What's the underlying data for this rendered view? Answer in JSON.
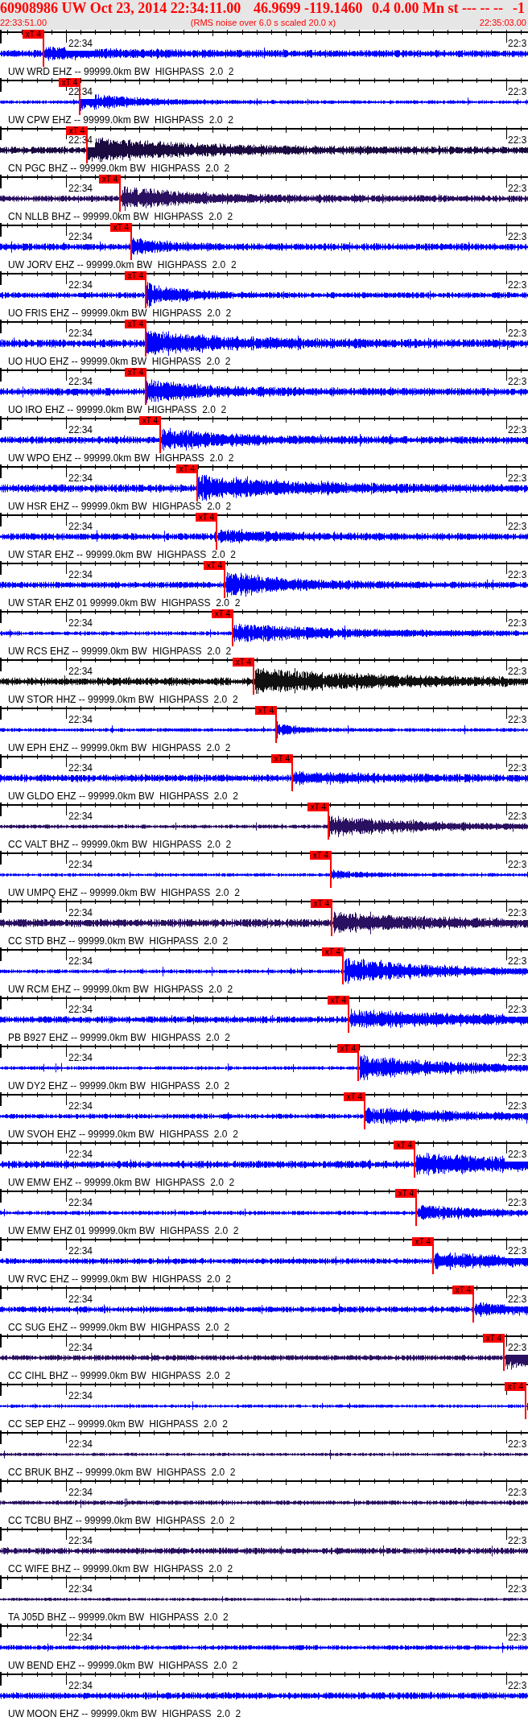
{
  "header": {
    "title_parts": [
      "60908986 UW Oct 23, 2014 22:34:11.00",
      "46.9699 -119.1460",
      "0.4 0.00 Mn st --- -- --",
      "-1"
    ],
    "start_time": "22:33:51.00",
    "note": "(RMS noise over 6.0 s scaled 20.0 x)",
    "end_time": "22:35:03.00"
  },
  "traces": [
    {
      "label": "UW WRD EHZ -- 99999.0km BW  HIGHPASS  2.0  2",
      "color": "#0000ff",
      "time_labels": [
        "22:34",
        "22:3"
      ],
      "pick": {
        "label": "xT 4",
        "level": 0.084
      }
    },
    {
      "label": "UW CPW EHZ -- 99999.0km BW  HIGHPASS  2.0  2",
      "color": "#0000ff",
      "time_labels": [
        "22:34",
        "22:3"
      ],
      "pick": {
        "label": "xT 4",
        "level": 0.152
      }
    },
    {
      "label": "CN PGC BHZ -- 99999.0km BW  HIGHPASS  2.0  2",
      "color": "#1a0a40",
      "time_labels": [
        "22:34",
        "22:3"
      ],
      "pick": {
        "label": "xT 4",
        "level": 0.166
      }
    },
    {
      "label": "CN NLLB BHZ -- 99999.0km BW  HIGHPASS  2.0  2",
      "color": "#2a1060",
      "time_labels": [
        "22:34",
        "22:3"
      ],
      "pick": {
        "label": "xT 4",
        "level": 0.229
      }
    },
    {
      "label": "UW JORV EHZ -- 99999.0km BW  HIGHPASS  2.0  2",
      "color": "#0000ff",
      "time_labels": [
        "22:34",
        "22:3"
      ],
      "pick": {
        "label": "xT 4",
        "level": 0.25
      }
    },
    {
      "label": "UO FRIS EHZ -- 99999.0km BW  HIGHPASS  2.0  2",
      "color": "#0000ff",
      "time_labels": [
        "22:34",
        "22:3"
      ],
      "pick": {
        "label": "xT 4",
        "level": 0.277
      }
    },
    {
      "label": "UO HUO EHZ -- 99999.0km BW  HIGHPASS  2.0  2",
      "color": "#0000ff",
      "time_labels": [
        "22:34",
        "22:3"
      ],
      "pick": {
        "label": "xT 4",
        "level": 0.277
      }
    },
    {
      "label": "UO IRO EHZ -- 99999.0km BW  HIGHPASS  2.0  2",
      "color": "#0000ff",
      "time_labels": [
        "22:34",
        "22:3"
      ],
      "pick": {
        "label": "xT 4",
        "level": 0.277
      }
    },
    {
      "label": "UW WPO EHZ -- 99999.0km BW  HIGHPASS  2.0  2",
      "color": "#0000ff",
      "time_labels": [
        "22:34",
        "22:3"
      ],
      "pick": {
        "label": "xT 4",
        "level": 0.305
      }
    },
    {
      "label": "UW HSR EHZ -- 99999.0km BW  HIGHPASS  2.0  2",
      "color": "#0000ff",
      "time_labels": [
        "22:34",
        "22:3"
      ],
      "pick": {
        "label": "xT 4",
        "level": 0.375
      }
    },
    {
      "label": "UW STAR EHZ -- 99999.0km BW  HIGHPASS  2.0  2",
      "color": "#0000ff",
      "time_labels": [
        "22:34",
        "22:3"
      ],
      "pick": {
        "label": "xT 4",
        "level": 0.412
      }
    },
    {
      "label": "UW STAR EHZ 01 99999.0km BW  HIGHPASS  2.0  2",
      "color": "#0000ff",
      "time_labels": [
        "22:34",
        "22:3"
      ],
      "pick": {
        "label": "xT 4",
        "level": 0.427
      }
    },
    {
      "label": "UW RCS EHZ -- 99999.0km BW  HIGHPASS  2.0  2",
      "color": "#0000ff",
      "time_labels": [
        "22:34",
        "22:3"
      ],
      "pick": {
        "label": "xT 4",
        "level": 0.442
      }
    },
    {
      "label": "UW STOR HHZ -- 99999.0km BW  HIGHPASS  2.0  2",
      "color": "#101010",
      "time_labels": [
        "22:34",
        "22:3"
      ],
      "pick": {
        "label": "xT 4",
        "level": 0.482
      }
    },
    {
      "label": "UW EPH EHZ -- 99999.0km BW  HIGHPASS  2.0  2",
      "color": "#0000ff",
      "time_labels": [
        "22:34",
        "22:3"
      ],
      "pick": {
        "label": "xT 4",
        "level": 0.524
      }
    },
    {
      "label": "UW GLDO EHZ -- 99999.0km BW  HIGHPASS  2.0  2",
      "color": "#0000ff",
      "time_labels": [
        "22:34",
        "22:3"
      ],
      "pick": {
        "label": "xT 4",
        "level": 0.555
      }
    },
    {
      "label": "CC VALT BHZ -- 99999.0km BW  HIGHPASS  2.0  2",
      "color": "#2a1060",
      "time_labels": [
        "22:34",
        "22:3"
      ],
      "pick": {
        "label": "xT 4",
        "level": 0.623
      }
    },
    {
      "label": "UW UMPQ EHZ -- 99999.0km BW  HIGHPASS  2.0  2",
      "color": "#0000ff",
      "time_labels": [
        "22:34",
        "22:3"
      ],
      "pick": {
        "label": "xT 4",
        "level": 0.628
      }
    },
    {
      "label": "CC STD BHZ -- 99999.0km BW  HIGHPASS  2.0  2",
      "color": "#2a1060",
      "time_labels": [
        "22:34",
        "22:3"
      ],
      "pick": {
        "label": "xT 4",
        "level": 0.63
      }
    },
    {
      "label": "UW RCM EHZ -- 99999.0km BW  HIGHPASS  2.0  2",
      "color": "#0000ff",
      "time_labels": [
        "22:34",
        "22:3"
      ],
      "pick": {
        "label": "xT 4",
        "level": 0.651
      }
    },
    {
      "label": "PB B927 EHZ -- 99999.0km BW  HIGHPASS  2.0  2",
      "color": "#0000ff",
      "time_labels": [
        "22:34",
        "22:3"
      ],
      "pick": {
        "label": "xT 4",
        "level": 0.662
      }
    },
    {
      "label": "UW DY2 EHZ -- 99999.0km BW  HIGHPASS  2.0  2",
      "color": "#0000ff",
      "time_labels": [
        "22:34",
        "22:3"
      ],
      "pick": {
        "label": "xT 4",
        "level": 0.68
      }
    },
    {
      "label": "UW SVOH EHZ -- 99999.0km BW  HIGHPASS  2.0  2",
      "color": "#0000ff",
      "time_labels": [
        "22:34",
        "22:3"
      ],
      "pick": {
        "label": "xT 4",
        "level": 0.692
      }
    },
    {
      "label": "UW EMW EHZ -- 99999.0km BW  HIGHPASS  2.0  2",
      "color": "#0000ff",
      "time_labels": [
        "22:34",
        "22:3"
      ],
      "pick": {
        "label": "xT 4",
        "level": 0.787
      }
    },
    {
      "label": "UW EMW EHZ 01 99999.0km BW  HIGHPASS  2.0  2",
      "color": "#0000ff",
      "time_labels": [
        "22:34",
        "22:3"
      ],
      "pick": {
        "label": "xT 4",
        "level": 0.79
      }
    },
    {
      "label": "UW RVC EHZ -- 99999.0km BW  HIGHPASS  2.0  2",
      "color": "#0000ff",
      "time_labels": [
        "22:34",
        "22:3"
      ],
      "pick": {
        "label": "xT 4",
        "level": 0.822
      }
    },
    {
      "label": "CC SUG EHZ -- 99999.0km BW  HIGHPASS  2.0  2",
      "color": "#0000ff",
      "time_labels": [
        "22:34",
        "22:3"
      ],
      "pick": {
        "label": "xT 4",
        "level": 0.898
      }
    },
    {
      "label": "CC CIHL BHZ -- 99999.0km BW  HIGHPASS  2.0  2",
      "color": "#2a1060",
      "time_labels": [
        "22:34",
        "22:3"
      ],
      "pick": {
        "label": "xT 4",
        "level": 0.956
      }
    },
    {
      "label": "CC SEP EHZ -- 99999.0km BW  HIGHPASS  2.0  2",
      "color": "#0000ff",
      "time_labels": [
        "22:34"
      ],
      "pick": {
        "label": "xT 4",
        "level": 0.997
      }
    },
    {
      "label": "CC BRUK BHZ -- 99999.0km BW  HIGHPASS  2.0  2",
      "color": "#2a1060",
      "time_labels": [
        "22:34",
        "22:3"
      ]
    },
    {
      "label": "CC TCBU BHZ -- 99999.0km BW  HIGHPASS  2.0  2",
      "color": "#2a1060",
      "time_labels": [
        "22:34",
        "22:3"
      ]
    },
    {
      "label": "CC WIFE BHZ -- 99999.0km BW  HIGHPASS  2.0  2",
      "color": "#2a1060",
      "time_labels": [
        "22:34",
        "22:3"
      ]
    },
    {
      "label": "TA J05D BHZ -- 99999.0km BW  HIGHPASS  2.0  2",
      "color": "#2a1060",
      "time_labels": [
        "22:34",
        "22:3"
      ]
    },
    {
      "label": "UW BEND EHZ -- 99999.0km BW  HIGHPASS  2.0  2",
      "color": "#0000ff",
      "time_labels": [
        "22:34",
        "22:3"
      ]
    },
    {
      "label": "UW MOON EHZ -- 99999.0km BW  HIGHPASS  2.0  2",
      "color": "#0000ff",
      "time_labels": [
        "22:34",
        "22:3"
      ]
    }
  ]
}
